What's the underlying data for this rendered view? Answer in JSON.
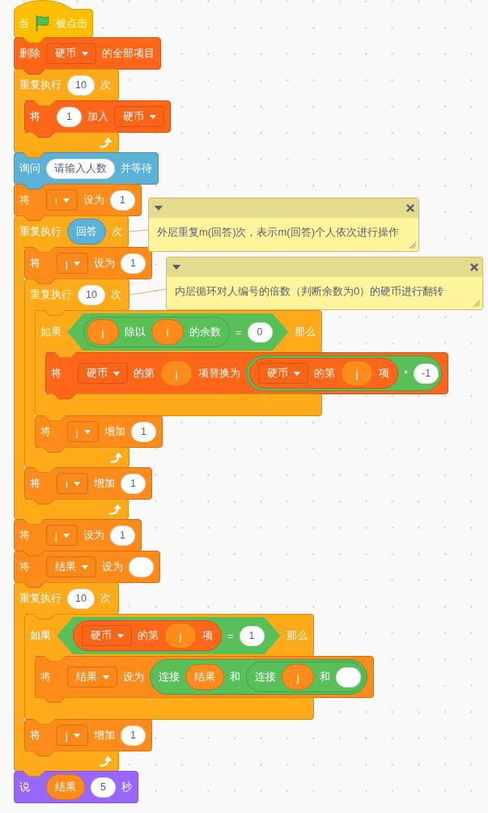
{
  "script": [
    {
      "kind": "hat",
      "color": "#ffbf00",
      "parts": [
        {
          "kind": "label",
          "text": "当"
        },
        {
          "kind": "flag"
        },
        {
          "kind": "label",
          "text": "被点击"
        }
      ]
    },
    {
      "kind": "stack",
      "color": "#ff661a",
      "parts": [
        {
          "kind": "label",
          "text": "删除"
        },
        {
          "kind": "dropdown",
          "text": "硬币"
        },
        {
          "kind": "label",
          "text": "的全部项目"
        }
      ]
    },
    {
      "kind": "repeat",
      "color": "#ffab19",
      "parts": [
        {
          "kind": "label",
          "text": "重复执行"
        },
        {
          "kind": "input",
          "text": "10"
        },
        {
          "kind": "label",
          "text": "次"
        }
      ],
      "children": [
        {
          "kind": "stack",
          "color": "#ff661a",
          "parts": [
            {
              "kind": "label",
              "text": "将"
            },
            {
              "kind": "input",
              "text": "1"
            },
            {
              "kind": "label",
              "text": "加入"
            },
            {
              "kind": "dropdown",
              "text": "硬币"
            }
          ]
        }
      ]
    },
    {
      "kind": "stack",
      "color": "#5cb1d6",
      "parts": [
        {
          "kind": "label",
          "text": "询问"
        },
        {
          "kind": "input",
          "text": "请输入人数"
        },
        {
          "kind": "label",
          "text": "并等待"
        }
      ]
    },
    {
      "kind": "stack",
      "color": "#ff8c1a",
      "parts": [
        {
          "kind": "label",
          "text": "将"
        },
        {
          "kind": "dropdown",
          "text": "i"
        },
        {
          "kind": "label",
          "text": "设为"
        },
        {
          "kind": "input",
          "text": "1"
        }
      ]
    },
    {
      "kind": "repeat",
      "color": "#ffab19",
      "parts": [
        {
          "kind": "label",
          "text": "重复执行"
        },
        {
          "kind": "reporter",
          "color": "#5cb1d6",
          "text": "回答"
        },
        {
          "kind": "label",
          "text": "次"
        }
      ],
      "comment": {
        "text": "外层重复m(回答)次，表示m(回答)个人依次进行操作"
      },
      "children": [
        {
          "kind": "stack",
          "color": "#ff8c1a",
          "parts": [
            {
              "kind": "label",
              "text": "将"
            },
            {
              "kind": "dropdown",
              "text": "j"
            },
            {
              "kind": "label",
              "text": "设为"
            },
            {
              "kind": "input",
              "text": "1"
            }
          ]
        },
        {
          "kind": "repeat",
          "color": "#ffab19",
          "parts": [
            {
              "kind": "label",
              "text": "重复执行"
            },
            {
              "kind": "input",
              "text": "10"
            },
            {
              "kind": "label",
              "text": "次"
            }
          ],
          "comment": {
            "text": "内层循环对人编号的倍数（判断余数为0）的硬币进行翻转"
          },
          "children": [
            {
              "kind": "if",
              "color": "#ffab19",
              "parts": [
                {
                  "kind": "label",
                  "text": "如果"
                },
                {
                  "kind": "boolean",
                  "color": "#59c059",
                  "parts": [
                    {
                      "kind": "reporter",
                      "color": "#59c059",
                      "parts": [
                        {
                          "kind": "reporter",
                          "color": "#ff8c1a",
                          "text": "j"
                        },
                        {
                          "kind": "label",
                          "text": "除以"
                        },
                        {
                          "kind": "reporter",
                          "color": "#ff8c1a",
                          "text": "i"
                        },
                        {
                          "kind": "label",
                          "text": "的余数"
                        }
                      ]
                    },
                    {
                      "kind": "label",
                      "text": "="
                    },
                    {
                      "kind": "input",
                      "text": "0"
                    }
                  ]
                },
                {
                  "kind": "label",
                  "text": "那么"
                }
              ],
              "children": [
                {
                  "kind": "stack",
                  "color": "#ff661a",
                  "parts": [
                    {
                      "kind": "label",
                      "text": "将"
                    },
                    {
                      "kind": "dropdown",
                      "text": "硬币"
                    },
                    {
                      "kind": "label",
                      "text": "的第"
                    },
                    {
                      "kind": "reporter",
                      "color": "#ff8c1a",
                      "text": "j"
                    },
                    {
                      "kind": "label",
                      "text": "项替换为"
                    },
                    {
                      "kind": "reporter",
                      "color": "#59c059",
                      "parts": [
                        {
                          "kind": "reporter",
                          "color": "#ff661a",
                          "parts": [
                            {
                              "kind": "dropdown",
                              "text": "硬币"
                            },
                            {
                              "kind": "label",
                              "text": "的第"
                            },
                            {
                              "kind": "reporter",
                              "color": "#ff8c1a",
                              "text": "j"
                            },
                            {
                              "kind": "label",
                              "text": "项"
                            }
                          ]
                        },
                        {
                          "kind": "label",
                          "text": "*"
                        },
                        {
                          "kind": "input",
                          "text": "-1"
                        }
                      ]
                    }
                  ]
                }
              ]
            },
            {
              "kind": "stack",
              "color": "#ff8c1a",
              "parts": [
                {
                  "kind": "label",
                  "text": "将"
                },
                {
                  "kind": "dropdown",
                  "text": "j"
                },
                {
                  "kind": "label",
                  "text": "增加"
                },
                {
                  "kind": "input",
                  "text": "1"
                }
              ]
            }
          ]
        },
        {
          "kind": "stack",
          "color": "#ff8c1a",
          "parts": [
            {
              "kind": "label",
              "text": "将"
            },
            {
              "kind": "dropdown",
              "text": "i"
            },
            {
              "kind": "label",
              "text": "增加"
            },
            {
              "kind": "input",
              "text": "1"
            }
          ]
        }
      ]
    },
    {
      "kind": "stack",
      "color": "#ff8c1a",
      "parts": [
        {
          "kind": "label",
          "text": "将"
        },
        {
          "kind": "dropdown",
          "text": "j"
        },
        {
          "kind": "label",
          "text": "设为"
        },
        {
          "kind": "input",
          "text": "1"
        }
      ]
    },
    {
      "kind": "stack",
      "color": "#ff8c1a",
      "parts": [
        {
          "kind": "label",
          "text": "将"
        },
        {
          "kind": "dropdown",
          "text": "结果"
        },
        {
          "kind": "label",
          "text": "设为"
        },
        {
          "kind": "input"
        }
      ]
    },
    {
      "kind": "repeat",
      "color": "#ffab19",
      "parts": [
        {
          "kind": "label",
          "text": "重复执行"
        },
        {
          "kind": "input",
          "text": "10"
        },
        {
          "kind": "label",
          "text": "次"
        }
      ],
      "children": [
        {
          "kind": "if",
          "color": "#ffab19",
          "parts": [
            {
              "kind": "label",
              "text": "如果"
            },
            {
              "kind": "boolean",
              "color": "#59c059",
              "parts": [
                {
                  "kind": "reporter",
                  "color": "#ff661a",
                  "parts": [
                    {
                      "kind": "dropdown",
                      "text": "硬币"
                    },
                    {
                      "kind": "label",
                      "text": "的第"
                    },
                    {
                      "kind": "reporter",
                      "color": "#ff8c1a",
                      "text": "j"
                    },
                    {
                      "kind": "label",
                      "text": "项"
                    }
                  ]
                },
                {
                  "kind": "label",
                  "text": "="
                },
                {
                  "kind": "input",
                  "text": "1"
                }
              ]
            },
            {
              "kind": "label",
              "text": "那么"
            }
          ],
          "children": [
            {
              "kind": "stack",
              "color": "#ff8c1a",
              "parts": [
                {
                  "kind": "label",
                  "text": "将"
                },
                {
                  "kind": "dropdown",
                  "text": "结果"
                },
                {
                  "kind": "label",
                  "text": "设为"
                },
                {
                  "kind": "reporter",
                  "color": "#59c059",
                  "parts": [
                    {
                      "kind": "label",
                      "text": "连接"
                    },
                    {
                      "kind": "reporter",
                      "color": "#ff8c1a",
                      "text": "结果"
                    },
                    {
                      "kind": "label",
                      "text": "和"
                    },
                    {
                      "kind": "reporter",
                      "color": "#59c059",
                      "parts": [
                        {
                          "kind": "label",
                          "text": "连接"
                        },
                        {
                          "kind": "reporter",
                          "color": "#ff8c1a",
                          "text": "j"
                        },
                        {
                          "kind": "label",
                          "text": "和"
                        },
                        {
                          "kind": "input"
                        }
                      ]
                    }
                  ]
                }
              ]
            }
          ]
        },
        {
          "kind": "stack",
          "color": "#ff8c1a",
          "parts": [
            {
              "kind": "label",
              "text": "将"
            },
            {
              "kind": "dropdown",
              "text": "j"
            },
            {
              "kind": "label",
              "text": "增加"
            },
            {
              "kind": "input",
              "text": "1"
            }
          ]
        }
      ]
    },
    {
      "kind": "stack",
      "color": "#9966ff",
      "parts": [
        {
          "kind": "label",
          "text": "说"
        },
        {
          "kind": "reporter",
          "color": "#ff8c1a",
          "text": "结果"
        },
        {
          "kind": "input",
          "text": "5"
        },
        {
          "kind": "label",
          "text": "秒"
        }
      ]
    }
  ]
}
